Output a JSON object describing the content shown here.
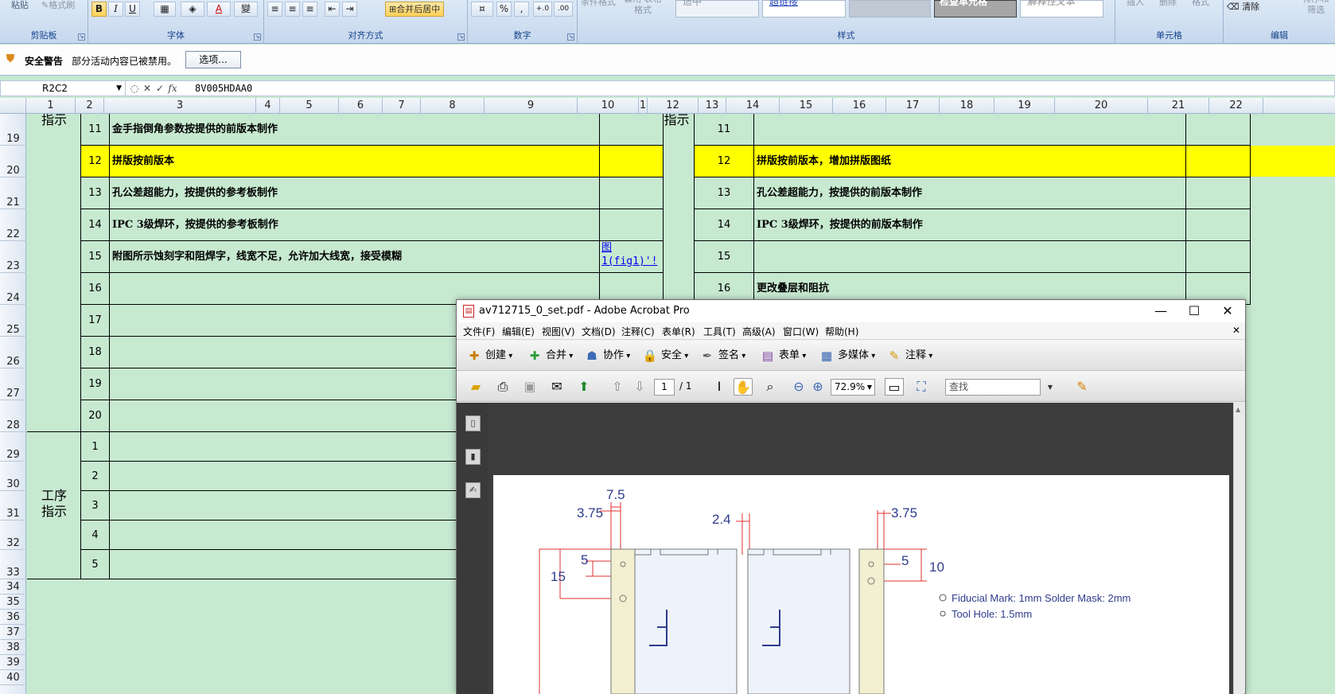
{
  "ribbon": {
    "paste_label": "粘贴",
    "format_painter": "格式刷",
    "groups": {
      "clipboard": "剪贴板",
      "font": "字体",
      "alignment": "对齐方式",
      "number": "数字",
      "styles": "样式",
      "cells": "单元格",
      "editing": "编辑"
    },
    "font_buttons": {
      "bold": "B",
      "italic": "I",
      "underline": "U",
      "font_color": "A",
      "phonetic": "變"
    },
    "merge_center": "合并后居中",
    "percent": "%",
    "thousands": ",",
    "inc_decimal": "+.0",
    "dec_decimal": ".00",
    "cond_format": "条件格式",
    "table_format": "套用 表格格式",
    "style_neutral": "适中",
    "style_hyperlink": "超链接",
    "style_check": "检查单元格",
    "style_explain": "解释性文本",
    "insert": "插入",
    "delete": "删除",
    "format": "格式",
    "clear": "清除",
    "sort_filter": "排序和 筛选"
  },
  "security": {
    "title": "安全警告",
    "message": "部分活动内容已被禁用。",
    "options_button": "选项..."
  },
  "formula_bar": {
    "name_box": "R2C2",
    "fx": "fx",
    "value": "8V005HDAA0"
  },
  "columns": [
    "1",
    "2",
    "3",
    "4",
    "5",
    "6",
    "7",
    "8",
    "9",
    "10",
    "1",
    "12",
    "13",
    "14",
    "15",
    "16",
    "17",
    "18",
    "19",
    "20",
    "21",
    "22"
  ],
  "rows": [
    "19",
    "20",
    "21",
    "22",
    "23",
    "24",
    "25",
    "26",
    "27",
    "28",
    "29",
    "30",
    "31",
    "32",
    "33",
    "34",
    "35",
    "36",
    "37",
    "38",
    "39",
    "40"
  ],
  "sheet": {
    "left_label_top": "指示",
    "left_label_process": "工序\n指示",
    "right_label_top": "指示",
    "left_rows": [
      {
        "n": "11",
        "text": "金手指倒角参数按提供的前版本制作"
      },
      {
        "n": "12",
        "text": "拼版按前版本"
      },
      {
        "n": "13",
        "text": "孔公差超能力，按提供的参考板制作"
      },
      {
        "n": "14",
        "text": "IPC 3级焊环，按提供的参考板制作"
      },
      {
        "n": "15",
        "text": "附图所示蚀刻字和阻焊字，线宽不足，允许加大线宽，接受模糊",
        "link": "图 1(fig1)'!"
      },
      {
        "n": "16",
        "text": ""
      },
      {
        "n": "17",
        "text": ""
      },
      {
        "n": "18",
        "text": ""
      },
      {
        "n": "19",
        "text": ""
      },
      {
        "n": "20",
        "text": ""
      }
    ],
    "process_rows": [
      "1",
      "2",
      "3",
      "4",
      "5"
    ],
    "right_rows": [
      {
        "n": "11",
        "text": ""
      },
      {
        "n": "12",
        "text": "拼版按前版本，增加拼版图纸"
      },
      {
        "n": "13",
        "text": "孔公差超能力，按提供的前版本制作"
      },
      {
        "n": "14",
        "text": "IPC 3级焊环，按提供的前版本制作"
      },
      {
        "n": "15",
        "text": ""
      },
      {
        "n": "16",
        "text": "更改叠层和阻抗"
      }
    ]
  },
  "acrobat": {
    "title": "av712715_0_set.pdf - Adobe Acrobat Pro",
    "menu": [
      "文件(F)",
      "编辑(E)",
      "视图(V)",
      "文档(D)",
      "注释(C)",
      "表单(R)",
      "工具(T)",
      "高级(A)",
      "窗口(W)",
      "帮助(H)"
    ],
    "toolbar": [
      "创建",
      "合并",
      "协作",
      "安全",
      "签名",
      "表单",
      "多媒体",
      "注释"
    ],
    "page_current": "1",
    "page_total": "/ 1",
    "zoom": "72.9%",
    "search_placeholder": "查找",
    "drawing": {
      "dims": [
        "7.5",
        "3.75",
        "2.4",
        "3.75",
        "5",
        "5",
        "15",
        "10"
      ],
      "legend": [
        "Fiducial Mark: 1mm  Solder Mask: 2mm",
        "Tool Hole: 1.5mm"
      ]
    }
  }
}
